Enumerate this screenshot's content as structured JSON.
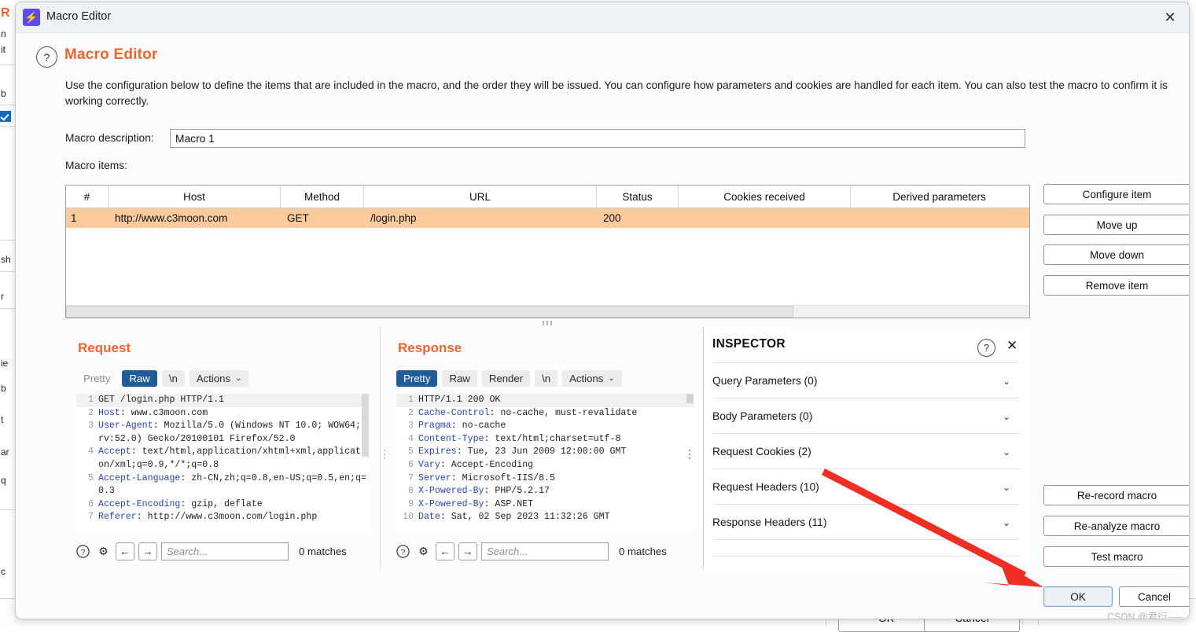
{
  "background": {
    "left_fragments": [
      "R",
      "n",
      "it",
      "b",
      "sh",
      "r",
      "ie",
      "b",
      "t",
      "ar",
      "q",
      "c"
    ],
    "footer": {
      "ok_label": "OK",
      "cancel_label": "Cancel"
    }
  },
  "window": {
    "title": "Macro Editor",
    "app_icon": "⚡",
    "close_icon": "✕"
  },
  "header": {
    "help_icon": "?",
    "page_title": "Macro Editor",
    "intro": "Use the configuration below to define the items that are included in the macro, and the order they will be issued. You can configure how parameters and cookies are handled for each item. You can also test the macro to confirm it is working correctly."
  },
  "form": {
    "description_label": "Macro description:",
    "description_value": "Macro 1",
    "items_label": "Macro items:"
  },
  "table": {
    "columns": [
      "#",
      "Host",
      "Method",
      "URL",
      "Status",
      "Cookies received",
      "Derived parameters"
    ],
    "rows": [
      {
        "num": "1",
        "host": "http://www.c3moon.com",
        "method": "GET",
        "url": "/login.php",
        "status": "200",
        "cookies": "",
        "derived": ""
      }
    ]
  },
  "side_buttons": [
    "Configure item",
    "Move up",
    "Move down",
    "Remove item"
  ],
  "action_buttons": [
    "Re-record macro",
    "Re-analyze macro",
    "Test macro"
  ],
  "layout_toggle": {
    "options": [
      "side-by-side-icon",
      "stacked-icon",
      "single-icon"
    ],
    "selected": 0
  },
  "request": {
    "title": "Request",
    "tabs": [
      "Pretty",
      "Raw",
      "\\n"
    ],
    "active_tab": "Raw",
    "actions_label": "Actions",
    "caret_icon": "⌄",
    "lines": [
      {
        "n": "1",
        "key": "",
        "text": "GET /login.php HTTP/1.1"
      },
      {
        "n": "2",
        "key": "Host",
        "text": ": www.c3moon.com"
      },
      {
        "n": "3",
        "key": "User-Agent",
        "text": ": Mozilla/5.0 (Windows NT 10.0; WOW64; rv:52.0) Gecko/20100101 Firefox/52.0"
      },
      {
        "n": "4",
        "key": "Accept",
        "text": ": text/html,application/xhtml+xml,application/xml;q=0.9,*/*;q=0.8"
      },
      {
        "n": "5",
        "key": "Accept-Language",
        "text": ": zh-CN,zh;q=0.8,en-US;q=0.5,en;q=0.3"
      },
      {
        "n": "6",
        "key": "Accept-Encoding",
        "text": ": gzip, deflate"
      },
      {
        "n": "7",
        "key": "Referer",
        "text": ": http://www.c3moon.com/login.php"
      }
    ],
    "find": {
      "help_icon": "?",
      "settings_icon": "⚙",
      "prev_icon": "←",
      "next_icon": "→",
      "placeholder": "Search...",
      "matches": "0 matches"
    }
  },
  "response": {
    "title": "Response",
    "tabs": [
      "Pretty",
      "Raw",
      "Render",
      "\\n"
    ],
    "active_tab": "Pretty",
    "actions_label": "Actions",
    "caret_icon": "⌄",
    "lines": [
      {
        "n": "1",
        "key": "",
        "text": "HTTP/1.1 200 OK"
      },
      {
        "n": "2",
        "key": "Cache-Control",
        "text": ": no-cache, must-revalidate"
      },
      {
        "n": "3",
        "key": "Pragma",
        "text": ": no-cache"
      },
      {
        "n": "4",
        "key": "Content-Type",
        "text": ": text/html;charset=utf-8"
      },
      {
        "n": "5",
        "key": "Expires",
        "text": ": Tue, 23 Jun 2009 12:00:00 GMT"
      },
      {
        "n": "6",
        "key": "Vary",
        "text": ": Accept-Encoding"
      },
      {
        "n": "7",
        "key": "Server",
        "text": ": Microsoft-IIS/8.5"
      },
      {
        "n": "8",
        "key": "X-Powered-By",
        "text": ": PHP/5.2.17"
      },
      {
        "n": "9",
        "key": "X-Powered-By",
        "text": ": ASP.NET"
      },
      {
        "n": "10",
        "key": "Date",
        "text": ": Sat, 02 Sep 2023 11:32:26 GMT"
      }
    ],
    "find": {
      "help_icon": "?",
      "settings_icon": "⚙",
      "prev_icon": "←",
      "next_icon": "→",
      "placeholder": "Search...",
      "matches": "0 matches"
    }
  },
  "inspector": {
    "title": "INSPECTOR",
    "help_icon": "?",
    "close_icon": "✕",
    "chevron_icon": "⌄",
    "sections": [
      "Query Parameters (0)",
      "Body Parameters (0)",
      "Request Cookies (2)",
      "Request Headers (10)",
      "Response Headers (11)"
    ]
  },
  "footer": {
    "ok_label": "OK",
    "cancel_label": "Cancel"
  },
  "annotation": {
    "arrow_color": "#ef2f24",
    "watermark": "CSDN @君衍⸺"
  },
  "colors": {
    "accent_orange": "#ec6630",
    "row_highlight": "#fbcb9e",
    "tab_active": "#1f5c99",
    "title_bar": "#eef2f7"
  }
}
